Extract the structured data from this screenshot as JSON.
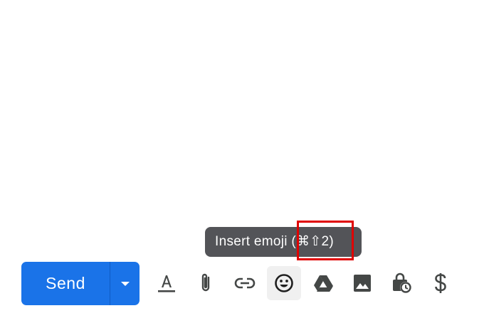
{
  "tooltip": {
    "text": "Insert emoji (⌘⇧2)"
  },
  "send_group": {
    "send_label": "Send",
    "options_icon": "caret-down-icon"
  },
  "toolbar": {
    "icons": [
      "formatting-options-icon",
      "attach-files-icon",
      "insert-link-icon",
      "insert-emoji-icon",
      "google-drive-icon",
      "insert-photo-icon",
      "confidential-mode-icon",
      "request-money-icon"
    ],
    "active_icon": "insert-emoji-icon"
  },
  "colors": {
    "send_button": "#1a73e8",
    "tooltip_bg": "#535458",
    "icon": "#444746",
    "highlight": "#e00000"
  }
}
